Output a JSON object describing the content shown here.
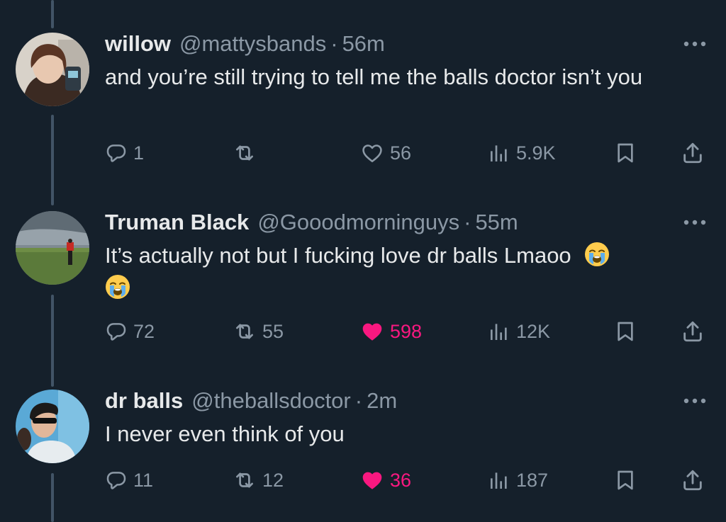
{
  "tweets": [
    {
      "name": "willow",
      "handle": "@mattysbands",
      "time": "56m",
      "text": "and you’re still trying to tell me the balls doctor isn’t you",
      "replies": "1",
      "retweets": "",
      "likes": "56",
      "views": "5.9K",
      "liked": false
    },
    {
      "name": "Truman Black",
      "handle": "@Gooodmorninguys",
      "time": "55m",
      "text": "It’s actually not but I fucking love dr balls Lmaoo",
      "replies": "72",
      "retweets": "55",
      "likes": "598",
      "views": "12K",
      "liked": true
    },
    {
      "name": "dr balls",
      "handle": "@theballsdoctor",
      "time": "2m",
      "text": "I never even think of you",
      "replies": "11",
      "retweets": "12",
      "likes": "36",
      "views": "187",
      "liked": true
    }
  ],
  "separator": "·",
  "colors": {
    "background": "#15202b",
    "text": "#e7e9ea",
    "muted": "#8b98a5",
    "like": "#f91880",
    "thread": "#425466"
  },
  "icons": [
    "reply-icon",
    "retweet-icon",
    "like-icon",
    "views-icon",
    "bookmark-icon",
    "share-icon",
    "more-icon",
    "loudly-crying-emoji"
  ]
}
